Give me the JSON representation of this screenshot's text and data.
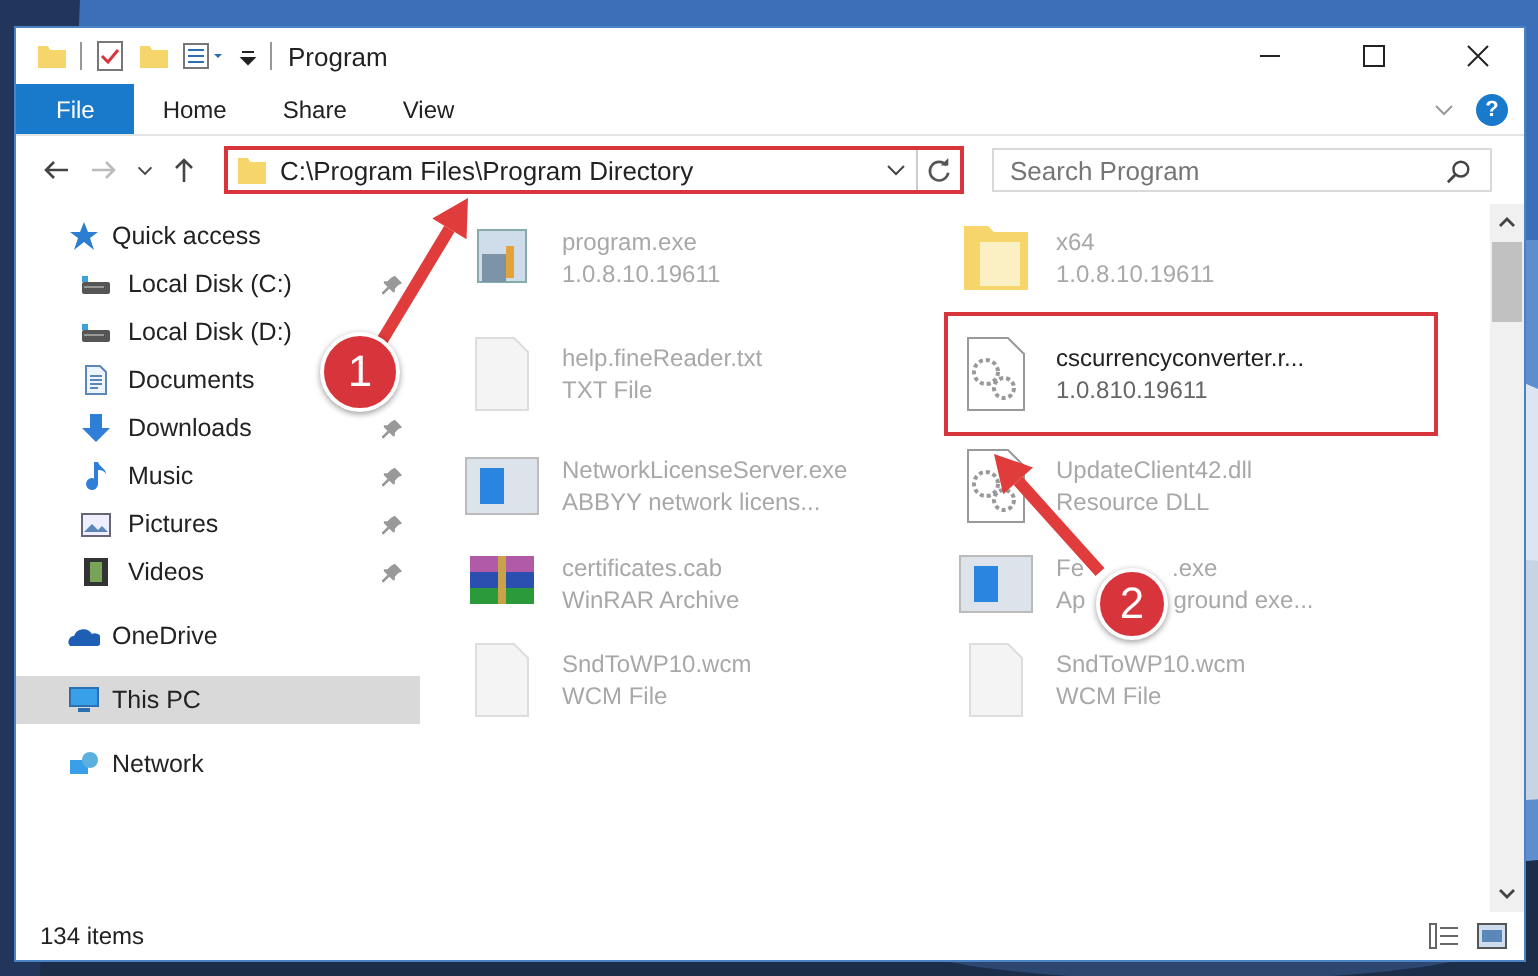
{
  "window": {
    "title": "Program"
  },
  "ribbon": {
    "tabs": [
      {
        "label": "File",
        "selected": true
      },
      {
        "label": "Home",
        "selected": false
      },
      {
        "label": "Share",
        "selected": false
      },
      {
        "label": "View",
        "selected": false
      }
    ],
    "help": "?"
  },
  "address_bar": {
    "path": "C:\\Program Files\\Program Directory",
    "highlighted": true
  },
  "search": {
    "placeholder": "Search Program"
  },
  "sidebar": {
    "items": [
      {
        "label": "Quick access",
        "kind": "star",
        "selected": false,
        "children": [
          {
            "label": "Local Disk (C:)",
            "kind": "drive",
            "selected": false,
            "pinned": true
          },
          {
            "label": "Local Disk (D:)",
            "kind": "drive",
            "selected": false,
            "pinned": false
          },
          {
            "label": "Documents",
            "kind": "document",
            "selected": false,
            "pinned": false
          },
          {
            "label": "Downloads",
            "kind": "download",
            "selected": false,
            "pinned": true
          },
          {
            "label": "Music",
            "kind": "music",
            "selected": false,
            "pinned": true
          },
          {
            "label": "Pictures",
            "kind": "pictures",
            "selected": false,
            "pinned": true
          },
          {
            "label": "Videos",
            "kind": "videos",
            "selected": false,
            "pinned": true
          }
        ]
      },
      {
        "label": "OneDrive",
        "kind": "cloud",
        "selected": false
      },
      {
        "label": "This PC",
        "kind": "computer",
        "selected": true
      },
      {
        "label": "Network",
        "kind": "network",
        "selected": false
      }
    ]
  },
  "files": [
    {
      "name": "program.exe",
      "detail": "1.0.8.10.19611",
      "kind": "installer",
      "highlighted": false
    },
    {
      "name": "x64",
      "detail": "1.0.8.10.19611",
      "kind": "folder",
      "highlighted": false
    },
    {
      "name": "help.fineReader.txt",
      "detail": "TXT File",
      "kind": "text",
      "highlighted": false
    },
    {
      "name": "cscurrencyconverter.r...",
      "detail": "1.0.810.19611",
      "kind": "gears",
      "highlighted": true
    },
    {
      "name": "NetworkLicenseServer.exe",
      "detail": "ABBYY network licens...",
      "kind": "app",
      "highlighted": false
    },
    {
      "name": "UpdateClient42.dll",
      "detail": "Resource DLL",
      "kind": "gears",
      "highlighted": false
    },
    {
      "name": "certificates.cab",
      "detail": "WinRAR Archive",
      "kind": "archive",
      "highlighted": false
    },
    {
      "name": "Fe",
      "name_end": ".exe",
      "detail": "Ap",
      "detail_end": "ground exe...",
      "kind": "app",
      "highlighted": false
    },
    {
      "name": "SndToWP10.wcm",
      "detail": "WCM File",
      "kind": "text",
      "highlighted": false
    },
    {
      "name": "SndToWP10.wcm",
      "detail": "WCM File",
      "kind": "text",
      "highlighted": false
    }
  ],
  "status_bar": {
    "item_count": "134 items"
  },
  "callouts": [
    {
      "label": "1"
    },
    {
      "label": "2"
    }
  ]
}
